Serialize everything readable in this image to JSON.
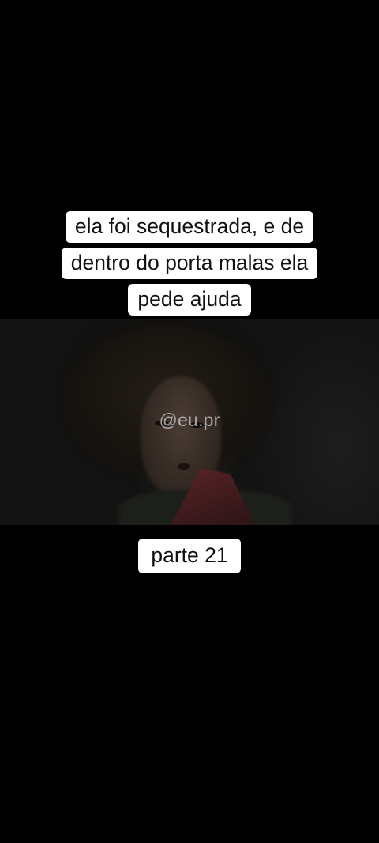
{
  "caption_top": {
    "line1": "ela foi sequestrada, e de",
    "line2": "dentro do porta malas ela",
    "line3": "pede ajuda"
  },
  "watermark": "@eu.pr",
  "caption_bottom": "parte 21",
  "colors": {
    "background": "#000000",
    "caption_box": "#ffffff",
    "caption_text": "#111111"
  }
}
